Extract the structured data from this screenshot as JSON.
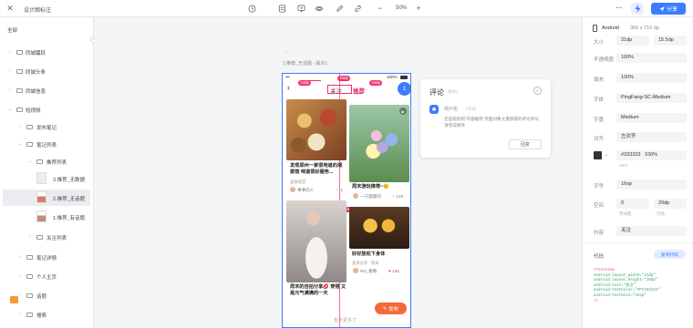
{
  "topbar": {
    "title": "设计图标注",
    "zoom": "50%",
    "share_label": "分享",
    "zoom_out": "−",
    "zoom_in": "+",
    "more": "···"
  },
  "sidebar": {
    "root": "全部",
    "items": [
      {
        "label": "同城踊跃"
      },
      {
        "label": "同城头条"
      },
      {
        "label": "同城信息"
      },
      {
        "label": "短视频"
      },
      {
        "label": "发布笔记"
      },
      {
        "label": "笔记列表"
      },
      {
        "label": "推荐列表"
      },
      {
        "label": "3.推荐_无数据"
      },
      {
        "label": "2.推荐_无话题"
      },
      {
        "label": "1.推荐_有话题"
      },
      {
        "label": "关注列表"
      },
      {
        "label": "笔记详情"
      },
      {
        "label": "个人主页"
      },
      {
        "label": "话题"
      },
      {
        "label": "搜索"
      }
    ]
  },
  "canvas": {
    "frame_title": "2.推荐_无话题 - 版本1",
    "bottom_hint": "暂无更多了",
    "phone": {
      "time": "9:41",
      "battery": "100%",
      "tab_follow": "关注",
      "tab_recommend": "推荐",
      "dim_1": "13dp",
      "dim_2": "35dp",
      "dim_3": "16dp",
      "dim_4": "109.5dp",
      "badge": "1",
      "publish_label": "发布",
      "cards": [
        {
          "caption": "发现郑州一家很地道的湘菜馆 味道很好服务...",
          "meta": "美食探店",
          "user": "事事的人",
          "likes": "1"
        },
        {
          "caption": "周末游玩推荐~😊",
          "meta": "",
          "user": "一只鹿鹿的",
          "likes": "126"
        },
        {
          "caption": "周末的自拍分享💋 穿搭 又是元气满满的一天",
          "meta": "",
          "user": "",
          "likes": ""
        },
        {
          "caption": "好好放松下身体",
          "meta": "美食分享 · 周末",
          "user": "NN_看看",
          "likes": "126"
        }
      ]
    }
  },
  "comment_panel": {
    "title": "评论",
    "count": "版本1",
    "user": "用户名",
    "time": "2天前",
    "text": "还是能找到“内容推荐”页面对象大量部落的评论评论请完成修改",
    "reply_label": "回复"
  },
  "props": {
    "device": "Android",
    "size": "360 x 710 dp",
    "size_label": "大小",
    "width": "31dp",
    "height": "15.5dp",
    "opacity_label": "不透明度",
    "opacity": "100%",
    "fill_label": "填充",
    "fill": "100%",
    "font_label": "字体",
    "font": "PingFang-SC-Medium",
    "weight_label": "字重",
    "weight": "Medium",
    "align_label": "对齐",
    "align": "左对齐",
    "color_hex": "#333333",
    "color_opacity": "100%",
    "hex_label": "HEX",
    "size_font_label": "字号",
    "font_size": "16sp",
    "spacing_label": "空间",
    "letter_spacing": "0",
    "line_height": "20dp",
    "letter_label": "字间距",
    "lineh_label": "行高",
    "content_label": "内容",
    "content": "关注",
    "code_label": "代码",
    "copy_label": "复制代码",
    "code": [
      "<TextView",
      "  android:layout_width=\"31dp\"",
      "  android:layout_height=\"16dp\"",
      "  android:text=\"关注\"",
      "  android:textColor=\"#FF333333\"",
      "  android:textSize=\"16sp\"",
      "/>"
    ],
    "accent": "#3b7cff"
  }
}
